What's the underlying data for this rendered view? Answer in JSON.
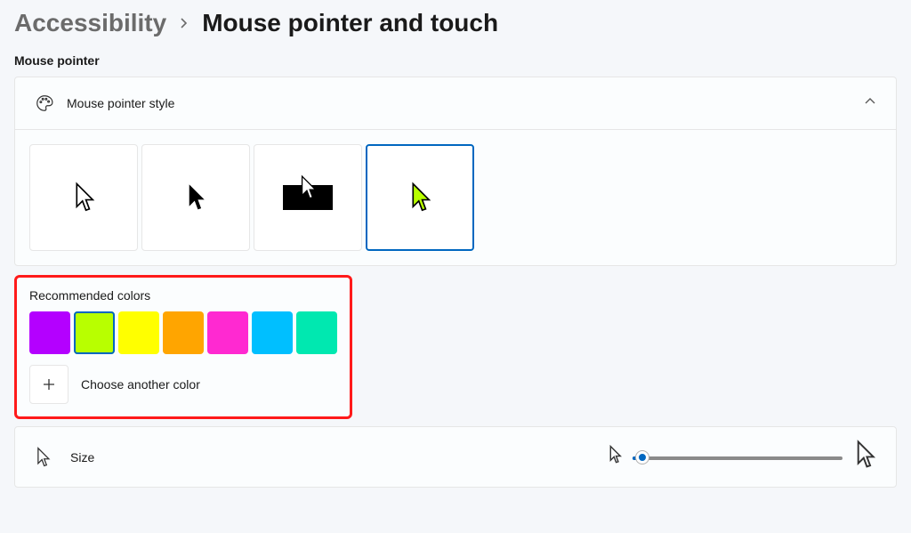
{
  "breadcrumb": {
    "parent": "Accessibility",
    "current": "Mouse pointer and touch"
  },
  "section_label": "Mouse pointer",
  "style_card": {
    "title": "Mouse pointer style"
  },
  "color_panel": {
    "title": "Recommended colors",
    "colors": [
      "#b400ff",
      "#b8ff00",
      "#ffff00",
      "#ffa500",
      "#ff29d1",
      "#00bfff",
      "#00e8b0"
    ],
    "selected_index": 1,
    "choose_another": "Choose another color"
  },
  "size_row": {
    "title": "Size"
  },
  "selected_style_index": 3
}
